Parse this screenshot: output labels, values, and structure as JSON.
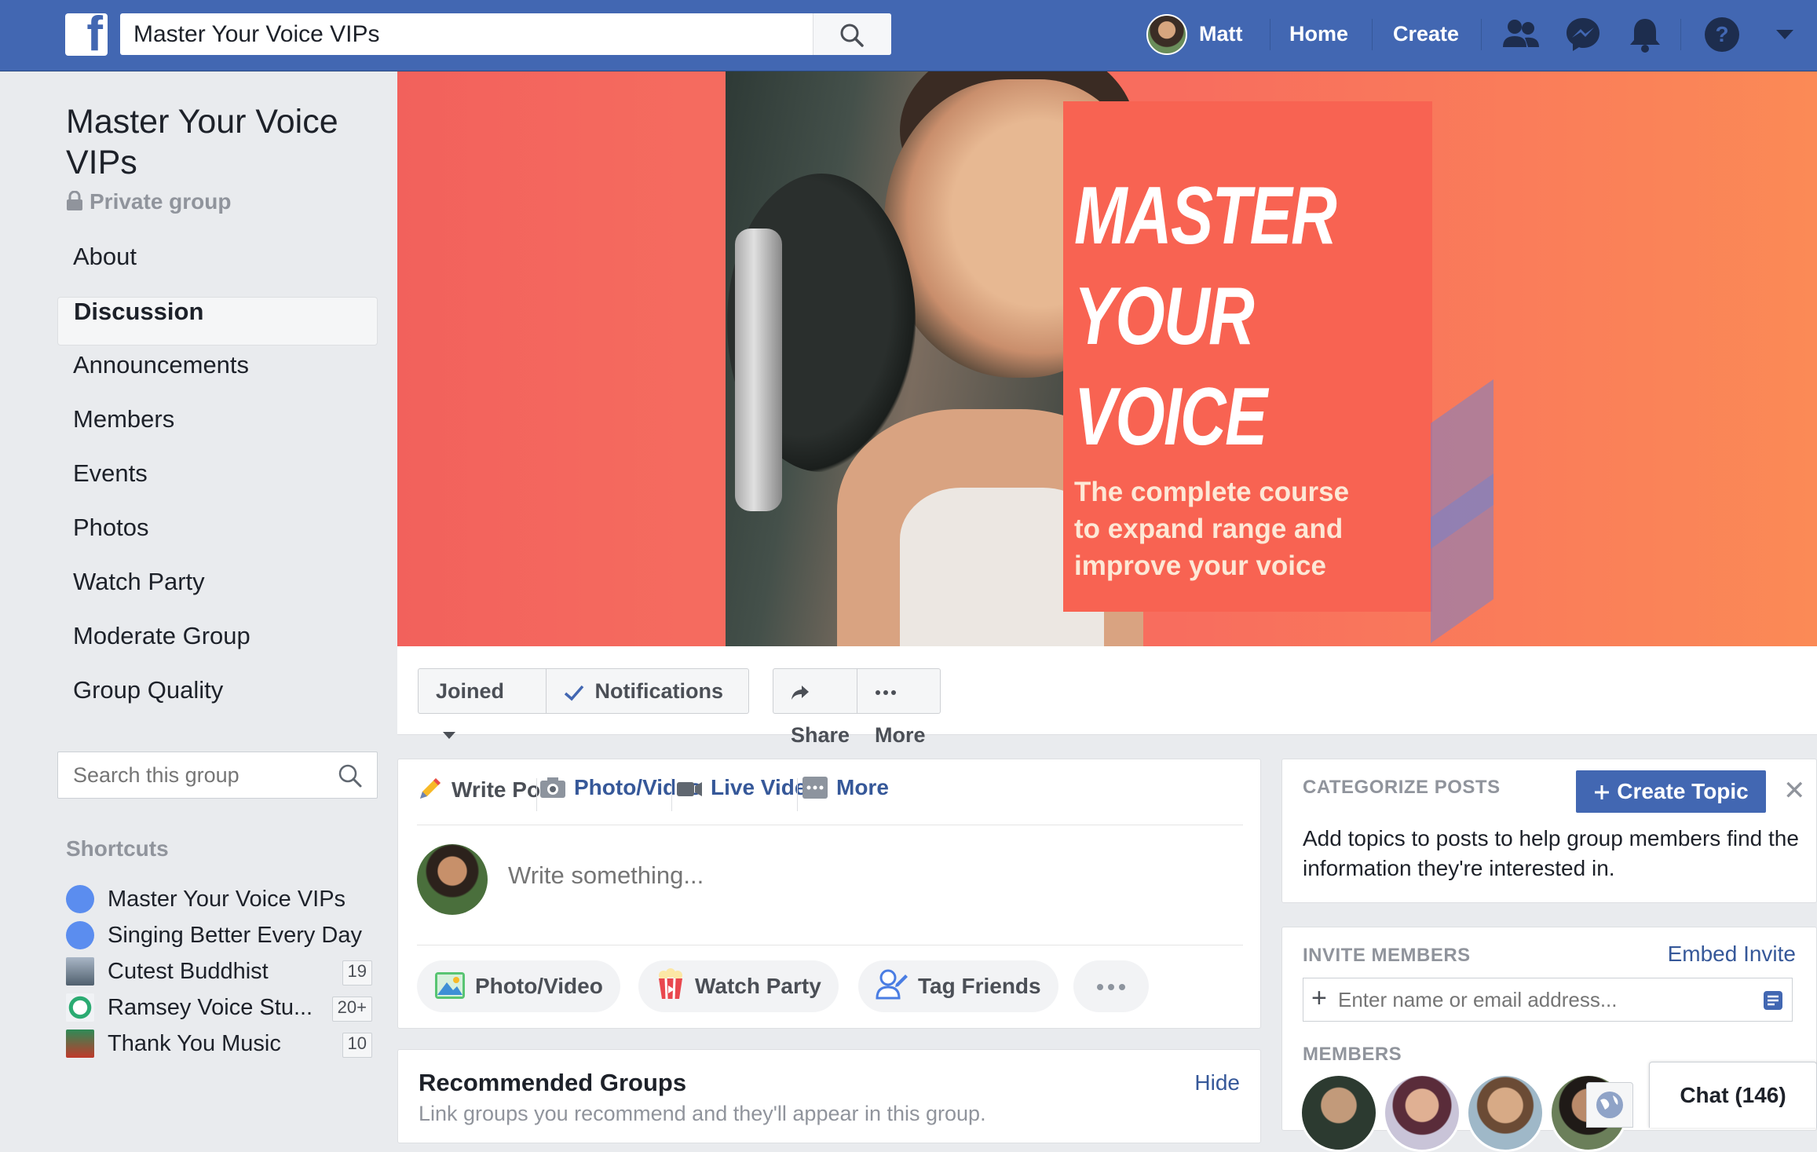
{
  "header": {
    "search_value": "Master Your Voice VIPs",
    "user_name": "Matt",
    "home_label": "Home",
    "create_label": "Create",
    "brand_color": "#4267b2"
  },
  "group": {
    "title": "Master Your Voice VIPs",
    "privacy": "Private group"
  },
  "sidebar": {
    "items": [
      {
        "label": "About",
        "active": false
      },
      {
        "label": "Discussion",
        "active": true
      },
      {
        "label": "Announcements",
        "active": false
      },
      {
        "label": "Members",
        "active": false
      },
      {
        "label": "Events",
        "active": false
      },
      {
        "label": "Photos",
        "active": false
      },
      {
        "label": "Watch Party",
        "active": false
      },
      {
        "label": "Moderate Group",
        "active": false
      },
      {
        "label": "Group Quality",
        "active": false
      }
    ],
    "search_placeholder": "Search this group",
    "shortcuts_heading": "Shortcuts",
    "shortcuts": [
      {
        "label": "Master Your Voice VIPs",
        "count": ""
      },
      {
        "label": "Singing Better Every Day",
        "count": ""
      },
      {
        "label": "Cutest Buddhist",
        "count": "19"
      },
      {
        "label": "Ramsey Voice Stu...",
        "count": "20+"
      },
      {
        "label": "Thank You Music",
        "count": "10"
      }
    ]
  },
  "cover": {
    "title_line1": "MASTER",
    "title_line2": "YOUR",
    "title_line3": "VOICE",
    "subtitle_line1": "The complete course",
    "subtitle_line2": "to expand range and",
    "subtitle_line3": "improve your voice"
  },
  "actions": {
    "joined": "Joined",
    "notifications": "Notifications",
    "share": "Share",
    "more": "More"
  },
  "composer": {
    "tabs": [
      "Write Post",
      "Photo/Video",
      "Live Video",
      "More"
    ],
    "placeholder": "Write something...",
    "pills": [
      "Photo/Video",
      "Watch Party",
      "Tag Friends"
    ]
  },
  "recommended": {
    "title": "Recommended Groups",
    "subtitle": "Link groups you recommend and they'll appear in this group.",
    "hide": "Hide"
  },
  "categorize": {
    "heading": "CATEGORIZE POSTS",
    "button": "Create Topic",
    "text": "Add topics to posts to help group members find the information they're interested in."
  },
  "invite": {
    "heading": "INVITE MEMBERS",
    "embed": "Embed Invite",
    "placeholder": "Enter name or email address...",
    "members_heading": "MEMBERS"
  },
  "chat": {
    "label": "Chat (146)"
  }
}
